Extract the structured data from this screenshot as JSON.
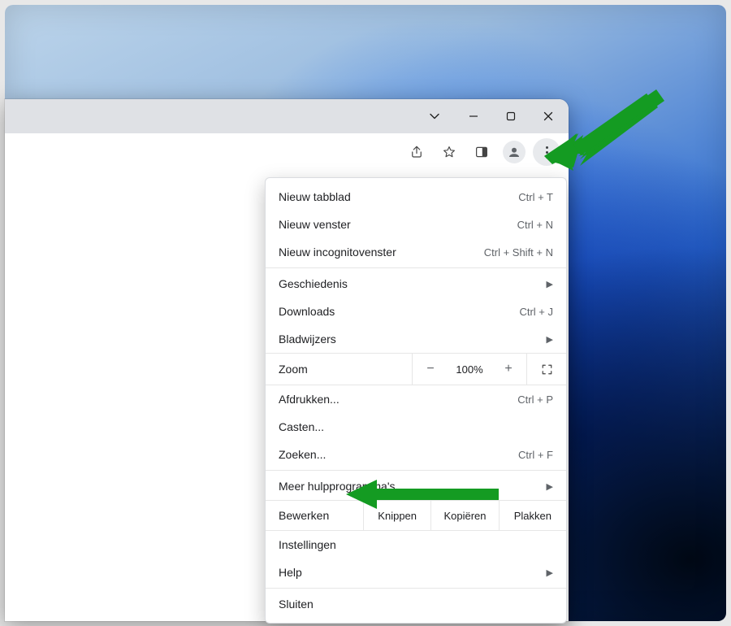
{
  "menu": {
    "newTab": {
      "label": "Nieuw tabblad",
      "shortcut": "Ctrl + T"
    },
    "newWindow": {
      "label": "Nieuw venster",
      "shortcut": "Ctrl + N"
    },
    "newIncognito": {
      "label": "Nieuw incognitovenster",
      "shortcut": "Ctrl + Shift + N"
    },
    "history": {
      "label": "Geschiedenis"
    },
    "downloads": {
      "label": "Downloads",
      "shortcut": "Ctrl + J"
    },
    "bookmarks": {
      "label": "Bladwijzers"
    },
    "zoom": {
      "label": "Zoom",
      "value": "100%"
    },
    "print": {
      "label": "Afdrukken...",
      "shortcut": "Ctrl + P"
    },
    "cast": {
      "label": "Casten..."
    },
    "find": {
      "label": "Zoeken...",
      "shortcut": "Ctrl + F"
    },
    "moreTools": {
      "label": "Meer hulpprogramma's"
    },
    "edit": {
      "label": "Bewerken",
      "cut": "Knippen",
      "copy": "Kopiëren",
      "paste": "Plakken"
    },
    "settings": {
      "label": "Instellingen"
    },
    "help": {
      "label": "Help"
    },
    "exit": {
      "label": "Sluiten"
    }
  }
}
